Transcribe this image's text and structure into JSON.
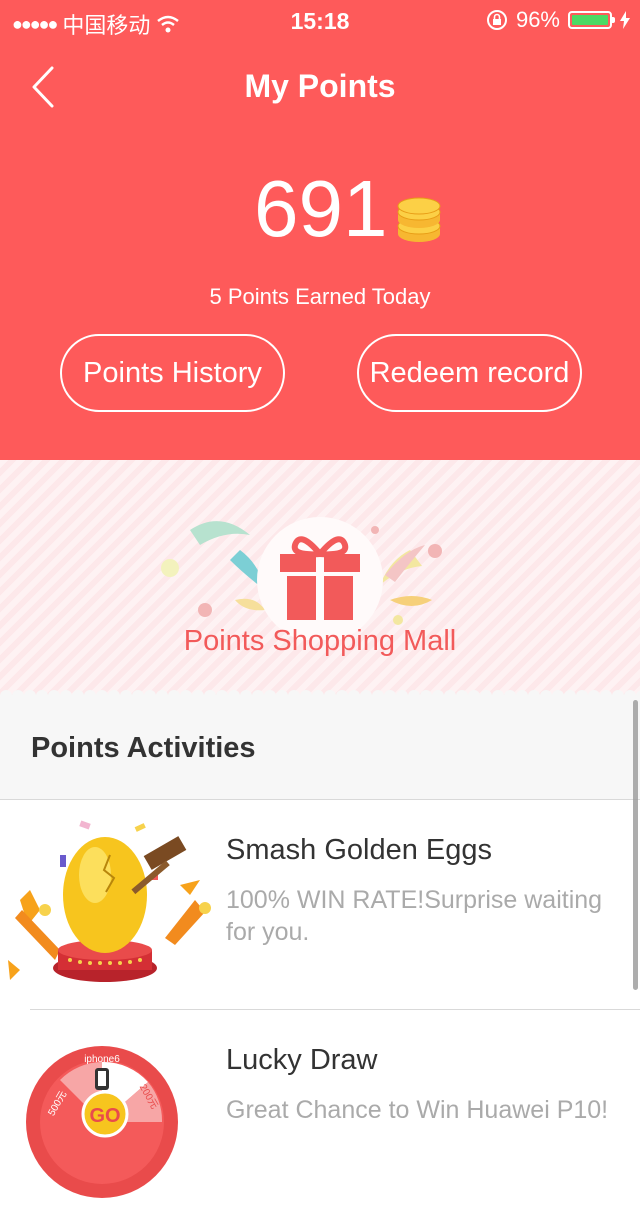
{
  "status_bar": {
    "carrier": "中国移动",
    "time": "15:18",
    "battery": "96%"
  },
  "header": {
    "title": "My Points",
    "points": "691",
    "earned_today": "5 Points Earned Today",
    "history_label": "Points History",
    "redeem_label": "Redeem record"
  },
  "mall": {
    "label": "Points Shopping Mall"
  },
  "activities": {
    "section_title": "Points Activities",
    "items": [
      {
        "title": "Smash Golden Eggs",
        "desc": "100% WIN RATE!Surprise waiting for you.",
        "icon": "golden-egg-icon"
      },
      {
        "title": "Lucky Draw",
        "desc": "Great Chance to Win Huawei P10!",
        "icon": "lucky-wheel-icon",
        "wheel_labels": [
          "iphone6",
          "GO",
          "500元",
          "200元"
        ]
      }
    ]
  },
  "colors": {
    "header_bg": "#fe5a5a",
    "banner_bg": "#fde8ea",
    "accent": "#f25a5a",
    "coin": "#f7b731"
  }
}
